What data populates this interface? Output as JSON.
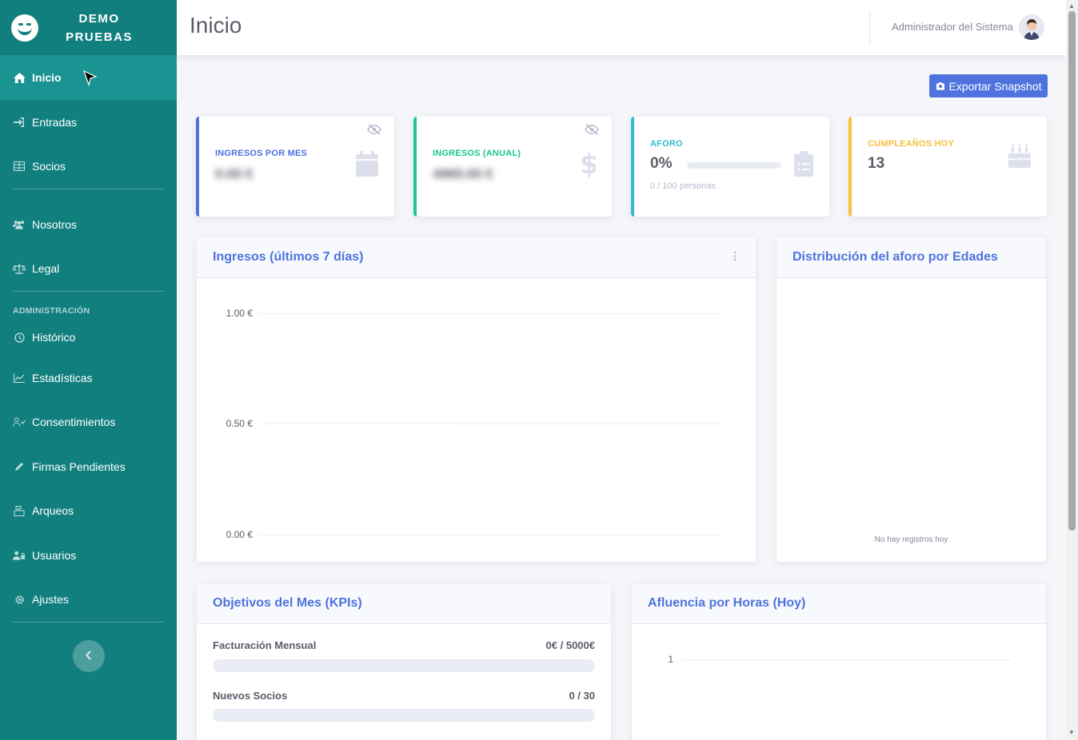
{
  "brand": {
    "line1": "DEMO",
    "line2": "PRUEBAS"
  },
  "sidebar": {
    "items": [
      {
        "label": "Inicio",
        "icon": "home-icon"
      },
      {
        "label": "Entradas",
        "icon": "sign-in-icon"
      },
      {
        "label": "Socios",
        "icon": "table-icon"
      },
      {
        "label": "Nosotros",
        "icon": "users-icon"
      },
      {
        "label": "Legal",
        "icon": "balance-scale-icon"
      },
      {
        "label": "Histórico",
        "icon": "history-icon"
      },
      {
        "label": "Estadísticas",
        "icon": "chart-line-icon"
      },
      {
        "label": "Consentimientos",
        "icon": "user-check-icon"
      },
      {
        "label": "Firmas Pendientes",
        "icon": "pen-icon"
      },
      {
        "label": "Arqueos",
        "icon": "cash-register-icon"
      },
      {
        "label": "Usuarios",
        "icon": "user-lock-icon"
      },
      {
        "label": "Ajustes",
        "icon": "cog-icon"
      }
    ],
    "heading_admin": "ADMINISTRACIÓN",
    "active": "Inicio"
  },
  "topbar": {
    "title": "Inicio",
    "user_name": "Administrador del Sistema"
  },
  "actions": {
    "export_label": "Exportar Snapshot"
  },
  "cards": {
    "ingresos_mes": {
      "label": "INGRESOS POR MES",
      "value": "0.00 €",
      "accent": "#4e73df"
    },
    "ingresos_anual": {
      "label": "INGRESOS (ANUAL)",
      "value": "4965.00 €",
      "accent": "#1cc88a"
    },
    "aforo": {
      "label": "AFORO",
      "value": "0%",
      "sub": "0 / 100 personas",
      "accent": "#36b9cc",
      "fill": 0
    },
    "cumples": {
      "label": "CUMPLEAÑOS HOY",
      "value": "13",
      "accent": "#f6c23e"
    }
  },
  "panels": {
    "ingresos7": {
      "title": "Ingresos (últimos 7 días)"
    },
    "edades": {
      "title": "Distribución del aforo por Edades",
      "empty": "No hay registros hoy"
    },
    "kpis": {
      "title": "Objetivos del Mes (KPIs)",
      "rows": [
        {
          "label": "Facturación Mensual",
          "value": "0€ / 5000€",
          "fill": 0
        },
        {
          "label": "Nuevos Socios",
          "value": "0 / 30",
          "fill": 0
        }
      ]
    },
    "afluencia": {
      "title": "Afluencia por Horas (Hoy)"
    }
  },
  "chart_data": [
    {
      "type": "line",
      "title": "Ingresos (últimos 7 días)",
      "yticks": [
        "1.00 €",
        "0.50 €",
        "0.00 €"
      ],
      "ylim": [
        0,
        1
      ],
      "series": [],
      "grid": true
    },
    {
      "type": "line",
      "title": "Afluencia por Horas (Hoy)",
      "yticks": [
        "1"
      ],
      "series": [],
      "grid": true
    }
  ]
}
